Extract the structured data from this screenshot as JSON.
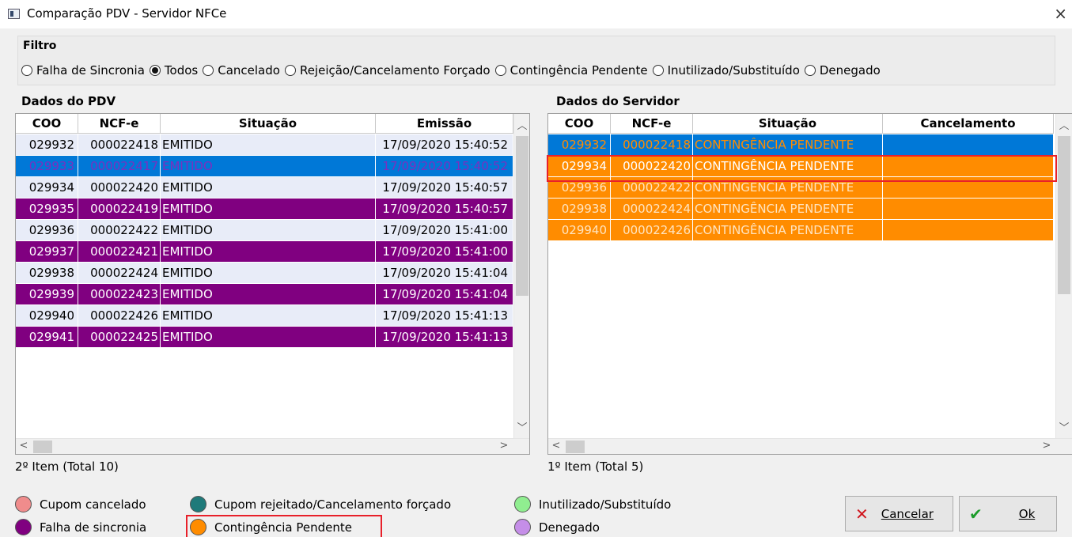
{
  "window": {
    "title": "Comparação PDV - Servidor NFCe",
    "close_glyph": "×"
  },
  "filter": {
    "title": "Filtro",
    "options": [
      {
        "label": "Falha de Sincronia",
        "selected": false
      },
      {
        "label": "Todos",
        "selected": true
      },
      {
        "label": "Cancelado",
        "selected": false
      },
      {
        "label": "Rejeição/Cancelamento Forçado",
        "selected": false
      },
      {
        "label": "Contingência Pendente",
        "selected": false
      },
      {
        "label": "Inutilizado/Substituído",
        "selected": false
      },
      {
        "label": "Denegado",
        "selected": false
      }
    ]
  },
  "pdv": {
    "title": "Dados do PDV",
    "columns": [
      "COO",
      "NCF-e",
      "Situação",
      "Emissão"
    ],
    "rows": [
      {
        "coo": "029932",
        "ncfe": "000022418",
        "situacao": "EMITIDO",
        "emissao": "17/09/2020 15:40:52",
        "style": "normal"
      },
      {
        "coo": "029933",
        "ncfe": "000022417",
        "situacao": "EMITIDO",
        "emissao": "17/09/2020 15:40:52",
        "style": "selected"
      },
      {
        "coo": "029934",
        "ncfe": "000022420",
        "situacao": "EMITIDO",
        "emissao": "17/09/2020 15:40:57",
        "style": "normal"
      },
      {
        "coo": "029935",
        "ncfe": "000022419",
        "situacao": "EMITIDO",
        "emissao": "17/09/2020 15:40:57",
        "style": "purple"
      },
      {
        "coo": "029936",
        "ncfe": "000022422",
        "situacao": "EMITIDO",
        "emissao": "17/09/2020 15:41:00",
        "style": "normal"
      },
      {
        "coo": "029937",
        "ncfe": "000022421",
        "situacao": "EMITIDO",
        "emissao": "17/09/2020 15:41:00",
        "style": "purple"
      },
      {
        "coo": "029938",
        "ncfe": "000022424",
        "situacao": "EMITIDO",
        "emissao": "17/09/2020 15:41:04",
        "style": "normal"
      },
      {
        "coo": "029939",
        "ncfe": "000022423",
        "situacao": "EMITIDO",
        "emissao": "17/09/2020 15:41:04",
        "style": "purple"
      },
      {
        "coo": "029940",
        "ncfe": "000022426",
        "situacao": "EMITIDO",
        "emissao": "17/09/2020 15:41:13",
        "style": "normal"
      },
      {
        "coo": "029941",
        "ncfe": "000022425",
        "situacao": "EMITIDO",
        "emissao": "17/09/2020 15:41:13",
        "style": "purple"
      }
    ],
    "status": "2º Item (Total 10)"
  },
  "servidor": {
    "title": "Dados do Servidor",
    "columns": [
      "COO",
      "NCF-e",
      "Situação",
      "Cancelamento"
    ],
    "rows": [
      {
        "coo": "029932",
        "ncfe": "000022418",
        "situacao": "CONTINGÊNCIA PENDENTE",
        "cancelamento": "",
        "style": "orange-selected"
      },
      {
        "coo": "029934",
        "ncfe": "000022420",
        "situacao": "CONTINGÊNCIA PENDENTE",
        "cancelamento": "",
        "style": "orange-focus"
      },
      {
        "coo": "029936",
        "ncfe": "000022422",
        "situacao": "CONTINGÊNCIA PENDENTE",
        "cancelamento": "",
        "style": "orange"
      },
      {
        "coo": "029938",
        "ncfe": "000022424",
        "situacao": "CONTINGÊNCIA PENDENTE",
        "cancelamento": "",
        "style": "orange"
      },
      {
        "coo": "029940",
        "ncfe": "000022426",
        "situacao": "CONTINGÊNCIA PENDENTE",
        "cancelamento": "",
        "style": "orange"
      }
    ],
    "status": "1º Item (Total 5)"
  },
  "legend": [
    {
      "label": "Cupom cancelado",
      "color": "#f08c8c"
    },
    {
      "label": "Falha de sincronia",
      "color": "#800080"
    },
    {
      "label": "Cupom rejeitado/Cancelamento forçado",
      "color": "#1f7a7a"
    },
    {
      "label": "Contingência Pendente",
      "color": "#ff8c00"
    },
    {
      "label": "Inutilizado/Substituído",
      "color": "#90ee90"
    },
    {
      "label": "Denegado",
      "color": "#c58ee8"
    }
  ],
  "buttons": {
    "cancel": "Cancelar",
    "ok": "Ok"
  },
  "colors": {
    "row_normal": "#e8ecf8",
    "row_selected": "#0078d7",
    "row_purple": "#800080",
    "row_orange": "#ff8c00",
    "text_selected_left": "#7b2fbf",
    "text_orange_selected": "#ff8c00",
    "text_orange": "#ffe4c0",
    "highlight_border": "#e8202a"
  }
}
